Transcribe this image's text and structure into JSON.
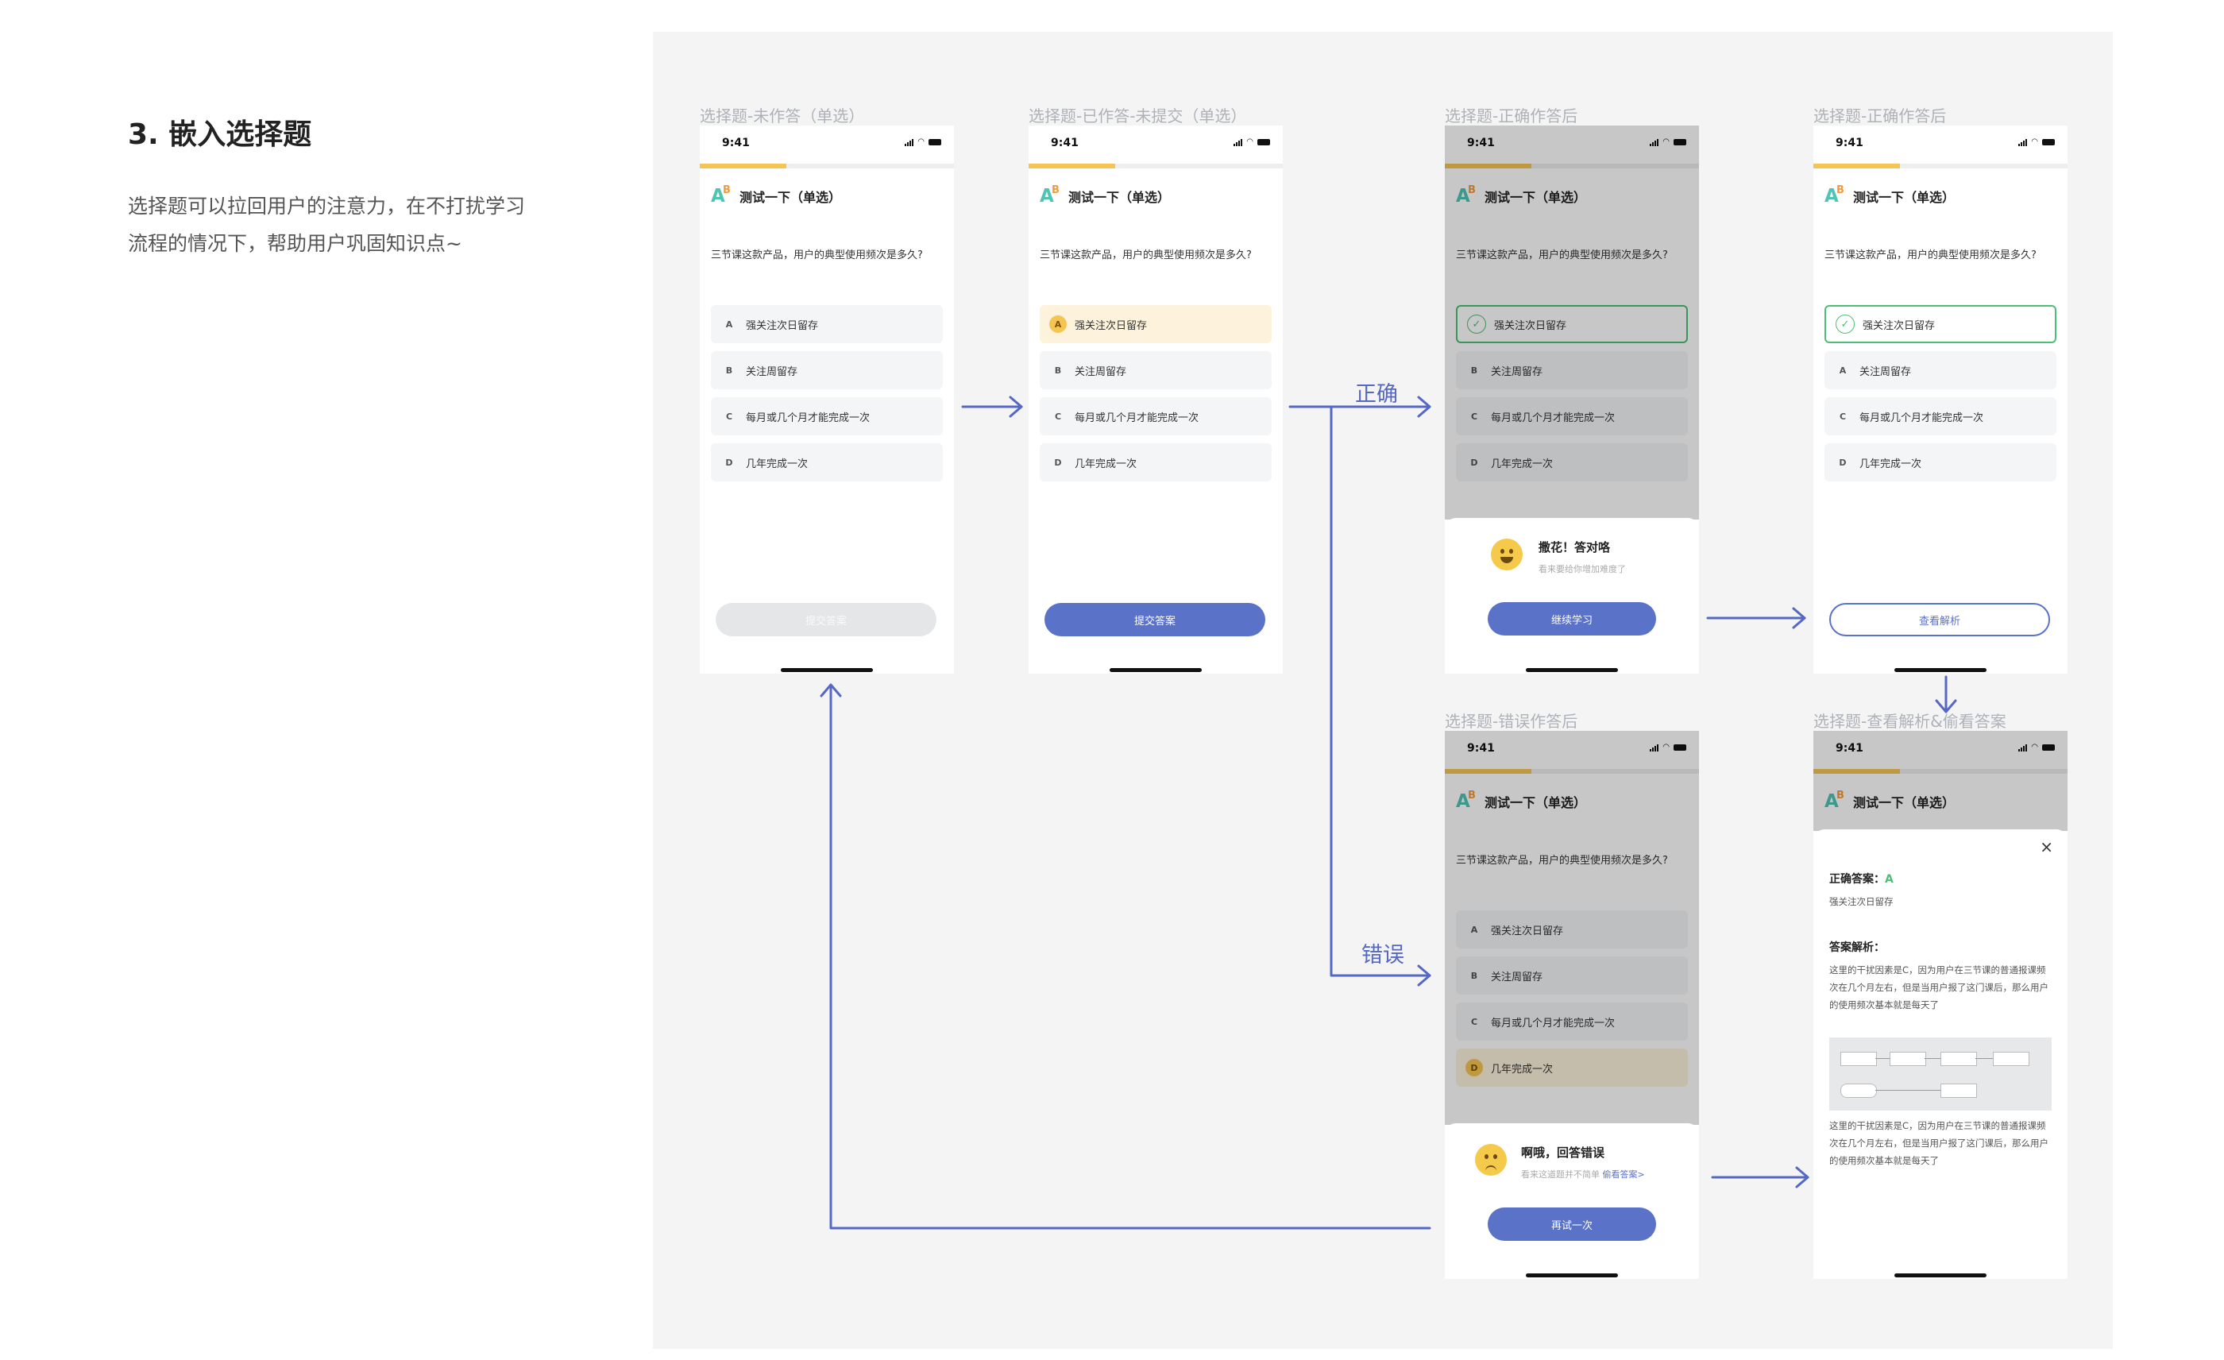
{
  "heading": "3. 嵌入选择题",
  "description": [
    "选择题可以拉回用户的注意力，在不打扰学习",
    "流程的情况下，帮助用户巩固知识点~"
  ],
  "colors": {
    "accent": "#5a72c8",
    "correct": "#4cbf74",
    "selected": "#f5c453",
    "progress": "#f5c453",
    "arrow": "#5468c4"
  },
  "common": {
    "time": "9:41",
    "quiz_title": "测试一下（单选）",
    "question": "三节课这款产品，用户的典型使用频次是多久?",
    "options": [
      {
        "letter": "A",
        "text": "强关注次日留存"
      },
      {
        "letter": "B",
        "text": "关注周留存"
      },
      {
        "letter": "C",
        "text": "每月或几个月才能完成一次"
      },
      {
        "letter": "D",
        "text": "几年完成一次"
      }
    ]
  },
  "screens": {
    "s1": {
      "label": "选择题-未作答（单选）",
      "button": "提交答案"
    },
    "s2": {
      "label": "选择题-已作答-未提交（单选）",
      "button": "提交答案"
    },
    "s3": {
      "label": "选择题-正确作答后",
      "feedback_title": "撒花！答对咯",
      "feedback_sub": "看来要给你增加难度了",
      "button": "继续学习",
      "check_icon": "✓"
    },
    "s4": {
      "label": "选择题-正确作答后",
      "button": "查看解析",
      "check_icon": "✓"
    },
    "s5": {
      "label": "选择题-错误作答后",
      "feedback_title": "啊哦，回答错误",
      "feedback_sub": "看来这道题并不简单",
      "feedback_link": "偷看答案>",
      "button": "再试一次"
    },
    "s6": {
      "label": "选择题-查看解析&偷看答案",
      "close": "×",
      "answer_label": "正确答案：",
      "answer_letter": "A",
      "answer_text": "强关注次日留存",
      "analysis_label": "答案解析：",
      "analysis_text": "这里的干扰因素是C，因为用户在三节课的普通报课频次在几个月左右，但是当用户报了这门课后，那么用户的使用频次基本就是每天了"
    }
  },
  "flow": {
    "correct": "正确",
    "wrong": "错误"
  }
}
